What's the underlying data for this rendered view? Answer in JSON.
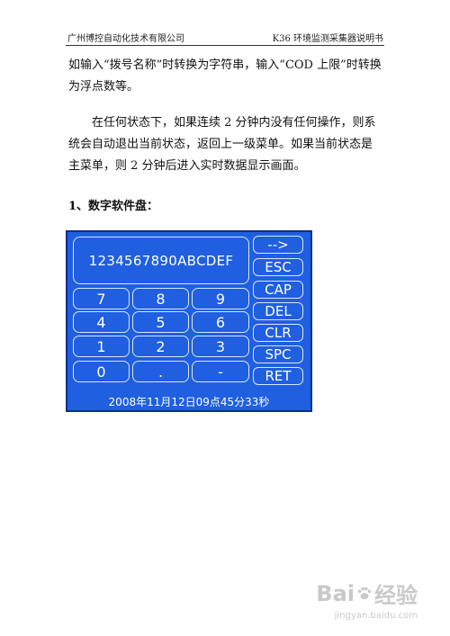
{
  "header": {
    "company": "广州博控自动化技术有限公司",
    "doc_title": "K36 环境监测采集器说明书"
  },
  "body": {
    "para1": "如输入“拨号名称”时转换为字符串，输入“COD 上限”时转换为浮点数等。",
    "para2": "在任何状态下，如果连续 2 分钟内没有任何操作，则系统会自动退出当前状态，返回上一级菜单。如果当前状态是主菜单，则 2 分钟后进入实时数据显示画面。",
    "heading": "1、数字软件盘："
  },
  "keypad": {
    "display_value": "1234567890ABCDEF",
    "keys": [
      "7",
      "8",
      "9",
      "4",
      "5",
      "6",
      "1",
      "2",
      "3",
      "0",
      ".",
      "-"
    ],
    "function_keys": [
      "-->",
      "ESC",
      "CAP",
      "DEL",
      "CLR",
      "SPC",
      "RET"
    ],
    "status_text": "2008年11月12日09点45分33秒",
    "panel_color": "#1f5fe0"
  },
  "watermark": {
    "brand": "Bai",
    "brand2": "经验",
    "url": "jingyan.baidu.com"
  }
}
